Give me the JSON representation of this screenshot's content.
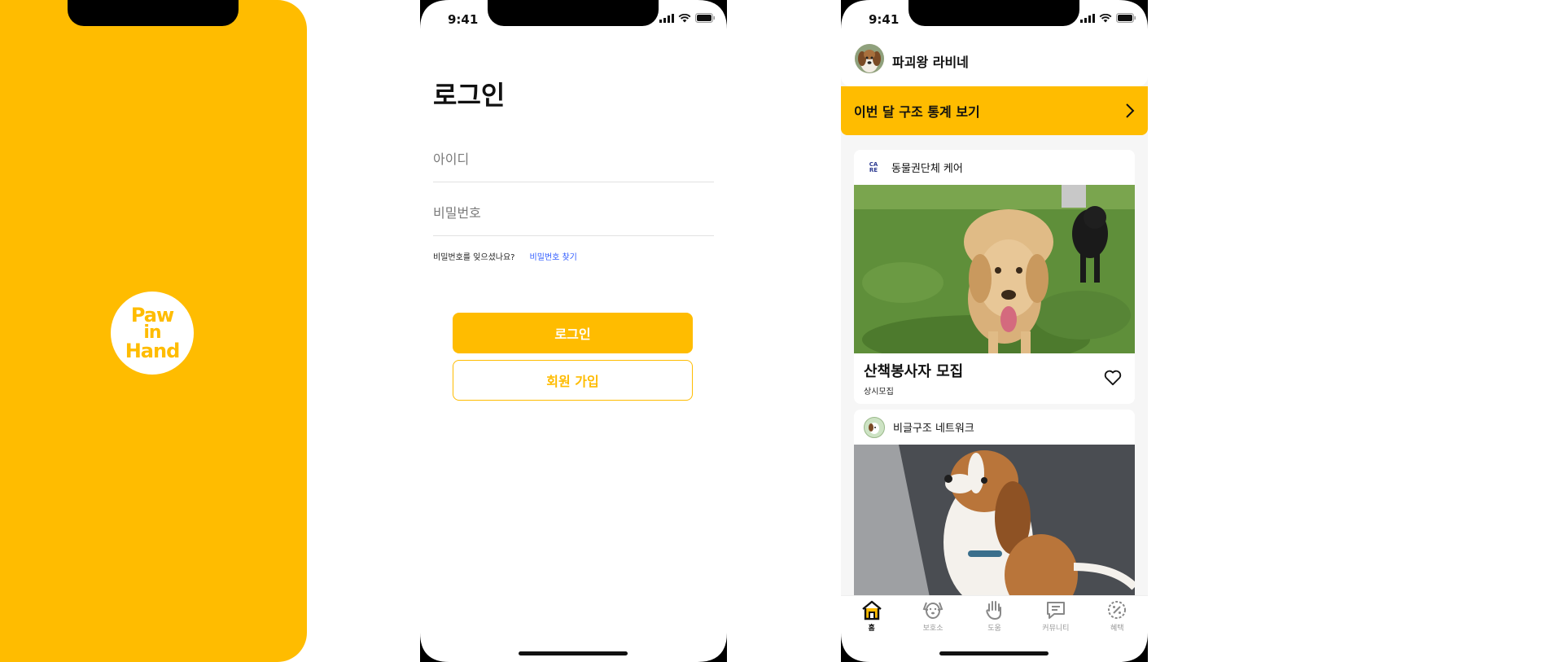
{
  "splash": {
    "logo_lines": [
      "Paw",
      "in",
      "Hand"
    ],
    "brand_color": "#FFBC00"
  },
  "status_bar": {
    "time": "9:41"
  },
  "login": {
    "title": "로그인",
    "id_placeholder": "아이디",
    "password_placeholder": "비밀번호",
    "forgot_text": "비밀번호를 잊으셨나요?",
    "forgot_link": "비밀번호 찾기",
    "login_button": "로그인",
    "signup_button": "회원 가입"
  },
  "home": {
    "username": "파괴왕 라비네",
    "stats_banner": "이번 달 구조 통계 보기",
    "cards": [
      {
        "org_name": "동물권단체 케어",
        "org_logo_text": "CA RE",
        "title": "산책봉사자 모집",
        "subtitle": "상시모집"
      },
      {
        "org_name": "비글구조 네트워크"
      }
    ],
    "tabs": [
      {
        "label": "홈",
        "icon": "home-icon",
        "active": true
      },
      {
        "label": "보호소",
        "icon": "dog-face-icon",
        "active": false
      },
      {
        "label": "도움",
        "icon": "hand-icon",
        "active": false
      },
      {
        "label": "커뮤니티",
        "icon": "chat-icon",
        "active": false
      },
      {
        "label": "혜택",
        "icon": "discount-icon",
        "active": false
      }
    ]
  },
  "colors": {
    "accent": "#FFBC00",
    "link": "#2F5BFF",
    "background_gray": "#F6F6F6"
  }
}
